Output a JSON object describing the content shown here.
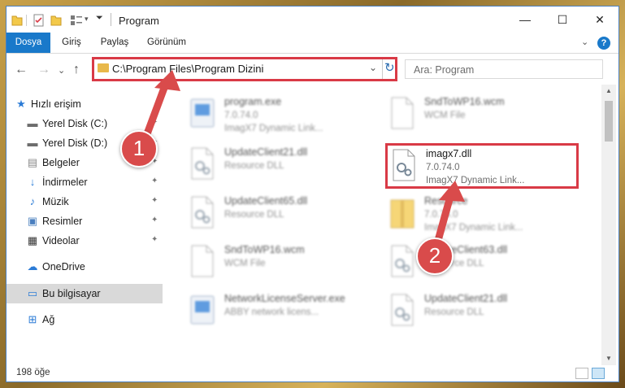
{
  "window": {
    "title": "Program",
    "controls": {
      "minimize": "—",
      "maximize": "☐",
      "close": "✕"
    }
  },
  "ribbon": {
    "tabs": [
      {
        "label": "Dosya",
        "active": true
      },
      {
        "label": "Giriş"
      },
      {
        "label": "Paylaş"
      },
      {
        "label": "Görünüm"
      }
    ],
    "expand": "⌄",
    "help": "?"
  },
  "nav": {
    "back": "←",
    "forward": "→",
    "recent": "⌄",
    "up": "↑"
  },
  "address": {
    "path": "C:\\Program Files\\Program Dizini",
    "dropdown": "⌄",
    "refresh": "↻"
  },
  "search": {
    "placeholder": "Ara: Program"
  },
  "sidebar": {
    "items": [
      {
        "label": "Hızlı erişim",
        "icon": "star-icon",
        "glyph": "★",
        "color": "#2b7bd6"
      },
      {
        "label": "Yerel Disk (C:)",
        "icon": "drive-icon",
        "glyph": "▬",
        "color": "#6d6d6d",
        "pinned": true
      },
      {
        "label": "Yerel Disk (D:)",
        "icon": "drive-icon",
        "glyph": "▬",
        "color": "#6d6d6d",
        "pinned": true
      },
      {
        "label": "Belgeler",
        "icon": "documents-icon",
        "glyph": "▤",
        "color": "#8a8a8a",
        "pinned": true
      },
      {
        "label": "İndirmeler",
        "icon": "download-icon",
        "glyph": "↓",
        "color": "#2b7bd6",
        "pinned": true
      },
      {
        "label": "Müzik",
        "icon": "music-icon",
        "glyph": "♪",
        "color": "#2b7bd6",
        "pinned": true
      },
      {
        "label": "Resimler",
        "icon": "pictures-icon",
        "glyph": "▣",
        "color": "#4a7fbf",
        "pinned": true
      },
      {
        "label": "Videolar",
        "icon": "videos-icon",
        "glyph": "▦",
        "color": "#333333",
        "pinned": true
      },
      {
        "label": "OneDrive",
        "icon": "cloud-icon",
        "glyph": "☁",
        "color": "#2b7bd6"
      },
      {
        "label": "Bu bilgisayar",
        "icon": "computer-icon",
        "glyph": "▭",
        "color": "#2b7bd6",
        "selected": true
      },
      {
        "label": "Ağ",
        "icon": "network-icon",
        "glyph": "⊞",
        "color": "#2b7bd6"
      }
    ],
    "pin_glyph": "📌"
  },
  "files": [
    {
      "name": "program.exe",
      "version": "7.0.74.0",
      "desc": "ImagX7 Dynamic Link...",
      "icon": "exe-icon"
    },
    {
      "name": "SndToWP16.wcm",
      "version": "WCM File",
      "desc": "",
      "icon": "blank-file-icon"
    },
    {
      "name": "UpdateClient21.dll",
      "version": "Resource DLL",
      "desc": "",
      "icon": "dll-icon"
    },
    {
      "name": "imagx7.dll",
      "version": "7.0.74.0",
      "desc": "ImagX7 Dynamic Link...",
      "icon": "dll-icon",
      "highlight": true
    },
    {
      "name": "UpdateClient65.dll",
      "version": "Resource DLL",
      "desc": "",
      "icon": "dll-icon"
    },
    {
      "name": "Resource",
      "version": "7.0.74.0",
      "desc": "ImagX7 Dynamic Link...",
      "icon": "archive-icon"
    },
    {
      "name": "SndToWP16.wcm",
      "version": "WCM File",
      "desc": "",
      "icon": "blank-file-icon"
    },
    {
      "name": "UpdateClient63.dll",
      "version": "Resource DLL",
      "desc": "",
      "icon": "dll-icon"
    },
    {
      "name": "NetworkLicenseServer.exe",
      "version": "ABBY network licens...",
      "desc": "",
      "icon": "exe-icon"
    },
    {
      "name": "UpdateClient21.dll",
      "version": "Resource DLL",
      "desc": "",
      "icon": "dll-icon"
    }
  ],
  "status": {
    "count": "198 öğe"
  },
  "markers": {
    "one": "1",
    "two": "2"
  },
  "colors": {
    "accent": "#1979ca",
    "highlight": "#d93a46",
    "marker": "#d94b4b"
  }
}
